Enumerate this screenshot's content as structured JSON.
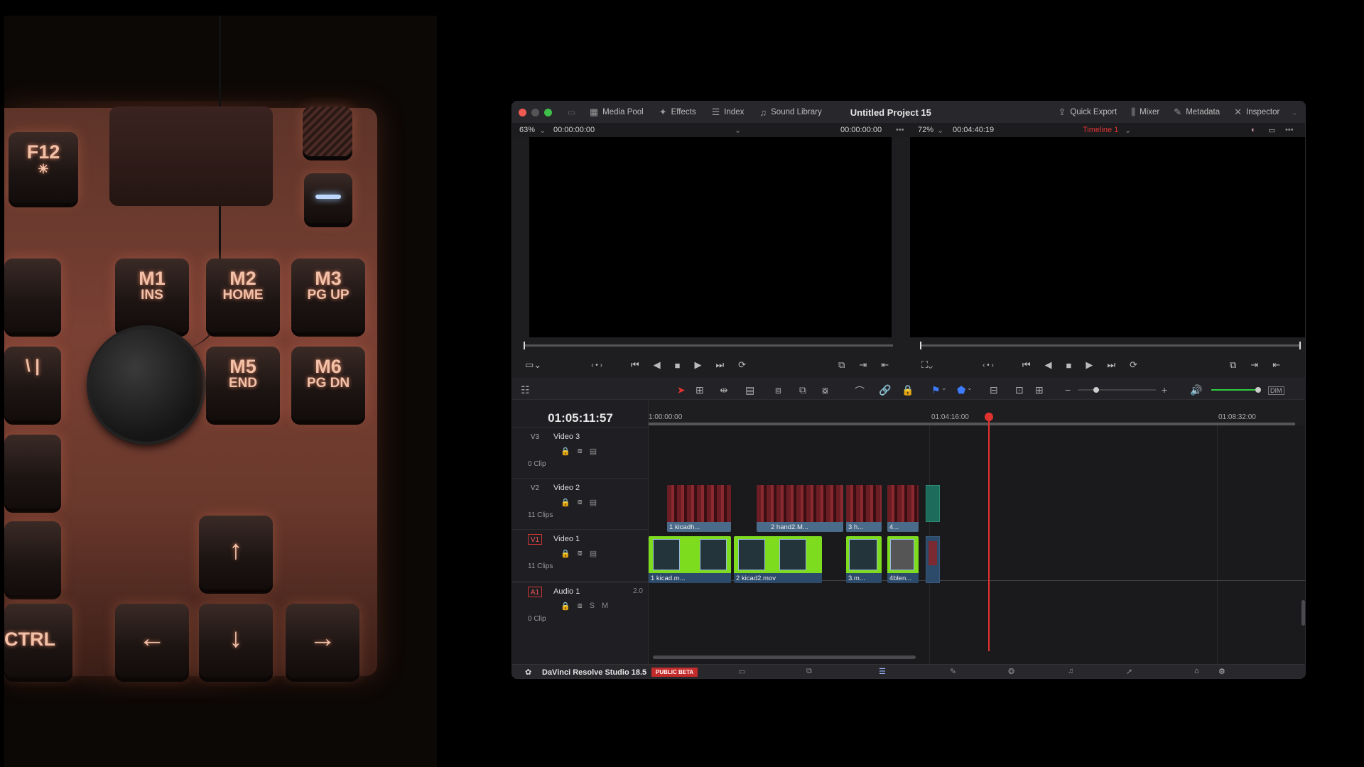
{
  "photo": {
    "keys": [
      {
        "line1": "F12",
        "line2": ""
      },
      {
        "line1": "M1",
        "line2": "INS"
      },
      {
        "line1": "M2",
        "line2": "HOME"
      },
      {
        "line1": "M3",
        "line2": "PG UP"
      },
      {
        "line1": "M5",
        "line2": "END"
      },
      {
        "line1": "M6",
        "line2": "PG DN"
      },
      {
        "line1": "CTRL",
        "line2": ""
      },
      {
        "line1": "↑",
        "line2": ""
      },
      {
        "line1": "←",
        "line2": ""
      },
      {
        "line1": "↓",
        "line2": ""
      },
      {
        "line1": "→",
        "line2": ""
      }
    ]
  },
  "app": {
    "title": "Untitled Project 15",
    "topbar": {
      "media_pool": "Media Pool",
      "effects": "Effects",
      "index": "Index",
      "sound_library": "Sound Library",
      "quick_export": "Quick Export",
      "mixer": "Mixer",
      "metadata": "Metadata",
      "inspector": "Inspector"
    },
    "source_viewer": {
      "zoom": "63%",
      "timecode_left": "00:00:00:00",
      "timecode_right": "00:00:00:00"
    },
    "timeline_viewer": {
      "zoom": "72%",
      "timecode": "00:04:40:19",
      "timeline_name": "Timeline 1"
    },
    "timeline": {
      "timecode": "01:05:11:57",
      "ruler": [
        "1:00:00:00",
        "01:04:16:00",
        "01:08:32:00"
      ],
      "tracks": [
        {
          "tag": "V3",
          "name": "Video 3",
          "count": "0 Clip"
        },
        {
          "tag": "V2",
          "name": "Video 2",
          "count": "11 Clips"
        },
        {
          "tag": "V1",
          "name": "Video 1",
          "count": "11 Clips"
        },
        {
          "tag": "A1",
          "name": "Audio 1",
          "count": "0 Clip",
          "level": "2.0"
        }
      ],
      "v2_clips": [
        "1 kicadh...",
        "2 hand2.M...",
        "3 h...",
        "4..."
      ],
      "v1_clips": [
        "1 kicad.m...",
        "2 kicad2.mov",
        "3.m...",
        "4blen..."
      ]
    },
    "footer": {
      "product": "DaVinci Resolve Studio 18.5",
      "badge": "PUBLIC BETA"
    },
    "colors": {
      "accent_red": "#e0332f",
      "clip_green": "#7edc1e",
      "audio_green": "#2ecc40"
    }
  }
}
